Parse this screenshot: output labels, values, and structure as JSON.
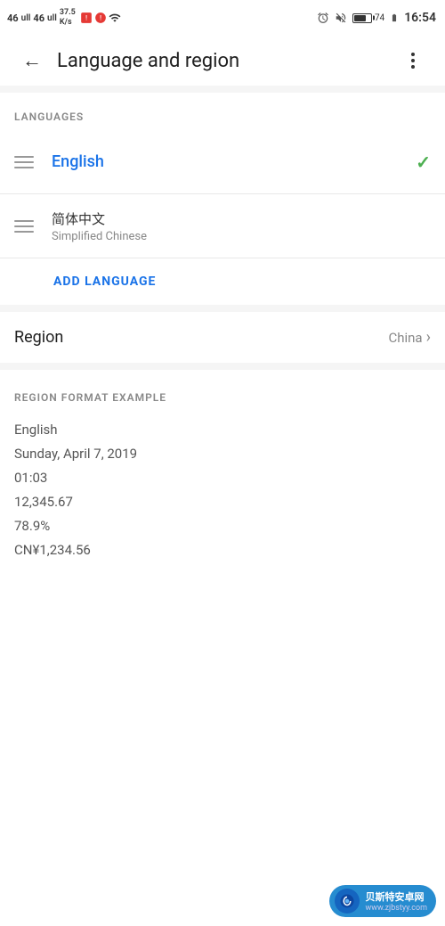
{
  "statusBar": {
    "carrier": "46",
    "signal": "46",
    "data": "37.5 K/s",
    "time": "16:54",
    "battery": "74"
  },
  "appBar": {
    "title": "Language and region",
    "backLabel": "back",
    "moreLabel": "more options"
  },
  "languages": {
    "sectionLabel": "LANGUAGES",
    "items": [
      {
        "name": "English",
        "subname": "",
        "selected": true
      },
      {
        "name": "简体中文",
        "subname": "Simplified Chinese",
        "selected": false
      }
    ],
    "addButton": "ADD LANGUAGE"
  },
  "region": {
    "label": "Region",
    "value": "China"
  },
  "regionFormat": {
    "sectionLabel": "REGION FORMAT EXAMPLE",
    "lines": [
      "English",
      "Sunday, April 7, 2019",
      "01:03",
      "12,345.67",
      "78.9%",
      "CN¥1,234.56"
    ]
  },
  "watermark": {
    "line1": "贝斯特安卓网",
    "line2": "www.zjbstyy.com"
  }
}
